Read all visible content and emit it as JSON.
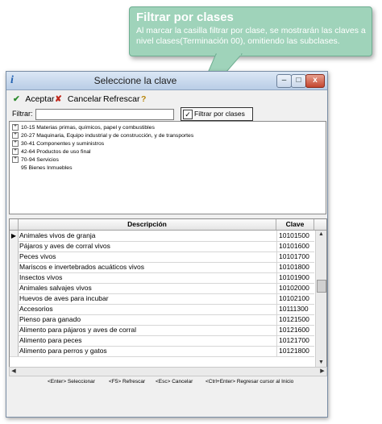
{
  "callout": {
    "title": "Filtrar por clases",
    "body": "Al marcar la casilla filtrar por clase, se mostrarán las claves a nivel clases(Terminación 00), omitiendo las subclases."
  },
  "window": {
    "title": "Seleccione la clave",
    "min": "–",
    "max": "□",
    "close": "x"
  },
  "toolbar": {
    "accept_icon": "✔",
    "accept_label": "Aceptar",
    "cancel_icon": "✘",
    "cancel_label": "Cancelar",
    "refresh_label": "Refrescar",
    "help_icon": "?"
  },
  "filter": {
    "label": "Filtrar:",
    "value": "",
    "checkbox_label": "Filtrar por clases",
    "checked_mark": "✓"
  },
  "tree": {
    "items": [
      {
        "expander": "+",
        "label": "10-15 Materias primas, químicos, papel y combustibles"
      },
      {
        "expander": "+",
        "label": "20-27 Maquinaria, Equipo industrial y de construcción, y de transportes"
      },
      {
        "expander": "+",
        "label": "30-41 Componentes y suministros"
      },
      {
        "expander": "+",
        "label": "42-64 Productos de uso final"
      },
      {
        "expander": "+",
        "label": "70-94 Servicios"
      },
      {
        "expander": "",
        "label": "95    Bienes Inmuebles"
      }
    ]
  },
  "grid": {
    "columns": {
      "description": "Descripción",
      "key": "Clave"
    },
    "current_row_marker": "▶",
    "rows": [
      {
        "description": "Animales vivos de granja",
        "key": "10101500"
      },
      {
        "description": "Pájaros y aves de corral vivos",
        "key": "10101600"
      },
      {
        "description": "Peces vivos",
        "key": "10101700"
      },
      {
        "description": "Mariscos e invertebrados acuáticos vivos",
        "key": "10101800"
      },
      {
        "description": "Insectos vivos",
        "key": "10101900"
      },
      {
        "description": "Animales salvajes vivos",
        "key": "10102000"
      },
      {
        "description": "Huevos de aves para incubar",
        "key": "10102100"
      },
      {
        "description": "Accesorios",
        "key": "10111300"
      },
      {
        "description": "Pienso para ganado",
        "key": "10121500"
      },
      {
        "description": "Alimento para pájaros y aves de corral",
        "key": "10121600"
      },
      {
        "description": "Alimento para peces",
        "key": "10121700"
      },
      {
        "description": "Alimento para perros y gatos",
        "key": "10121800"
      }
    ]
  },
  "status": {
    "hints": [
      "<Enter> Seleccionar",
      "<F5> Refrescar",
      "<Esc> Cancelar",
      "<Ctrl+Enter> Regresar cursor al Inicio"
    ]
  },
  "colors": {
    "callout_bg": "#9fd3ba",
    "titlebar": "#c6d8ee",
    "accept_green": "#2e8b2e",
    "cancel_red": "#c0281c"
  }
}
